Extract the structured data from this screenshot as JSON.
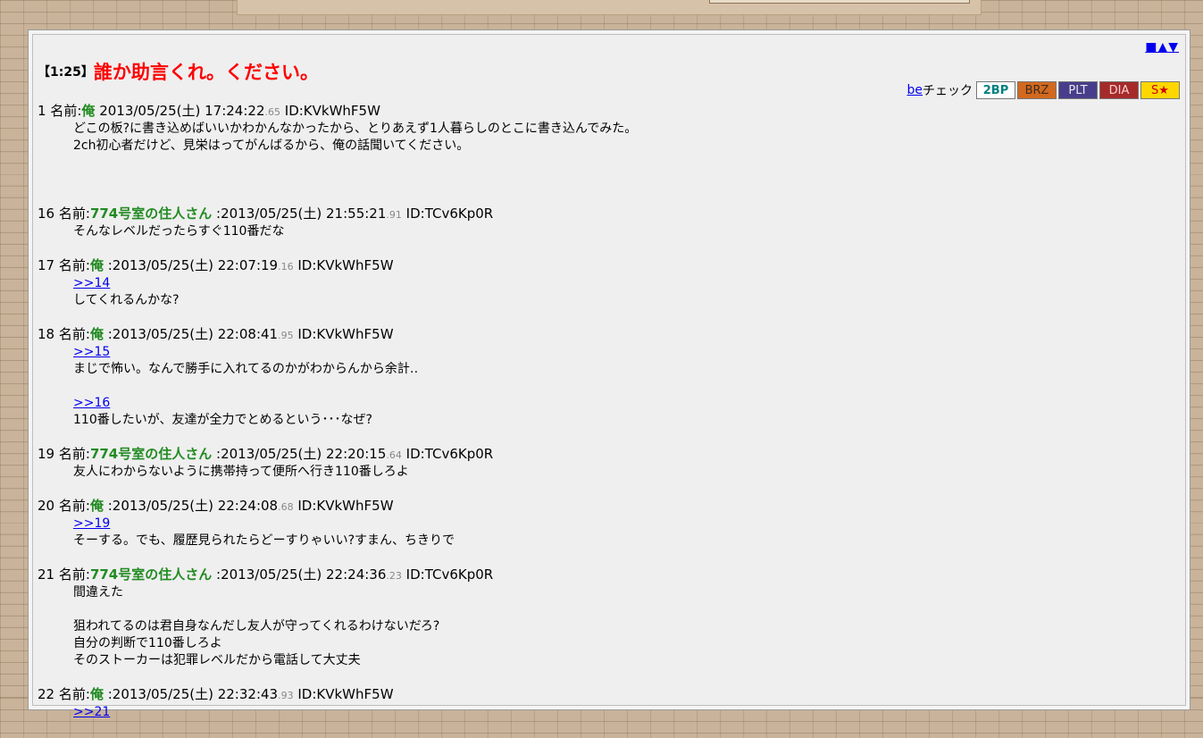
{
  "nav": {
    "arrows": "■▲▼"
  },
  "thread": {
    "number": "【1:25】",
    "title": "誰か助言くれ。ください。"
  },
  "be_bar": {
    "be_link": "be",
    "be_label": "チェック",
    "badges": [
      {
        "label": "2BP",
        "bg": "#ffffff",
        "fg": "#008080"
      },
      {
        "label": "BRZ",
        "bg": "#d2691e",
        "fg": "#3d2b1f"
      },
      {
        "label": "PLT",
        "bg": "#483d8b",
        "fg": "#e8e8e8"
      },
      {
        "label": "DIA",
        "bg": "#a52a2a",
        "fg": "#ffd0d0"
      },
      {
        "label": "S★",
        "bg": "#ffd700",
        "fg": "#d00000"
      }
    ]
  },
  "posts": [
    {
      "num": "1",
      "name_label": "名前:",
      "name": "俺",
      "datetime": "2013/05/25(土) 17:24:22",
      "ms": ".65",
      "id": "ID:KVkWhF5W",
      "lines": [
        "どこの板?に書き込めばいいかわかんなかったから、とりあえず1人暮らしのとこに書き込んでみた。",
        "2ch初心者だけど、見栄はってがんばるから、俺の話聞いてください。"
      ]
    },
    {
      "num": "16",
      "name_label": "名前:",
      "name": "774号室の住人さん",
      "datetime": ":2013/05/25(土) 21:55:21",
      "ms": ".91",
      "id": "ID:TCv6Kp0R",
      "lines": [
        "そんなレベルだったらすぐ110番だな"
      ]
    },
    {
      "num": "17",
      "name_label": "名前:",
      "name": "俺",
      "datetime": ":2013/05/25(土) 22:07:19",
      "ms": ".16",
      "id": "ID:KVkWhF5W",
      "anchor": ">>14",
      "lines": [
        "してくれるんかな?"
      ]
    },
    {
      "num": "18",
      "name_label": "名前:",
      "name": "俺",
      "datetime": ":2013/05/25(土) 22:08:41",
      "ms": ".95",
      "id": "ID:KVkWhF5W",
      "anchor": ">>15",
      "lines": [
        "まじで怖い。なんで勝手に入れてるのかがわからんから余計‥"
      ],
      "anchor2": ">>16",
      "lines2": [
        "110番したいが、友達が全力でとめるという･･･なぜ?"
      ]
    },
    {
      "num": "19",
      "name_label": "名前:",
      "name": "774号室の住人さん",
      "datetime": ":2013/05/25(土) 22:20:15",
      "ms": ".64",
      "id": "ID:TCv6Kp0R",
      "lines": [
        "友人にわからないように携帯持って便所へ行き110番しろよ"
      ]
    },
    {
      "num": "20",
      "name_label": "名前:",
      "name": "俺",
      "datetime": ":2013/05/25(土) 22:24:08",
      "ms": ".68",
      "id": "ID:KVkWhF5W",
      "anchor": ">>19",
      "lines": [
        "そーする。でも、履歴見られたらどーすりゃいい?すまん、ちきりで"
      ]
    },
    {
      "num": "21",
      "name_label": "名前:",
      "name": "774号室の住人さん",
      "datetime": ":2013/05/25(土) 22:24:36",
      "ms": ".23",
      "id": "ID:TCv6Kp0R",
      "lines": [
        "間違えた",
        "",
        "狙われてるのは君自身なんだし友人が守ってくれるわけないだろ?",
        "自分の判断で110番しろよ",
        "そのストーカーは犯罪レベルだから電話して大丈夫"
      ]
    },
    {
      "num": "22",
      "name_label": "名前:",
      "name": "俺",
      "datetime": ":2013/05/25(土) 22:32:43",
      "ms": ".93",
      "id": "ID:KVkWhF5W",
      "anchor": ">>21",
      "lines": []
    }
  ]
}
